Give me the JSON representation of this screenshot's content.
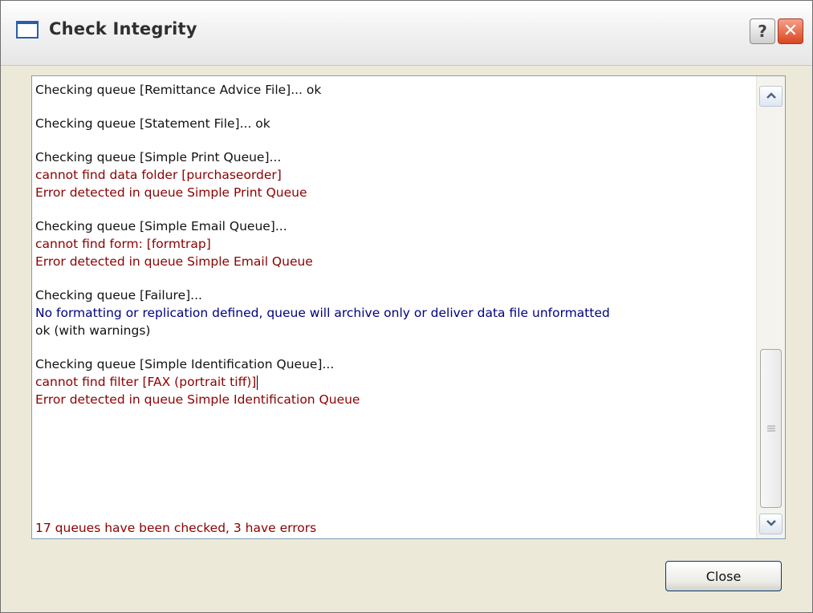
{
  "window": {
    "title": "Check Integrity",
    "help_label": "?",
    "close_label": "✕"
  },
  "log": {
    "lines": [
      {
        "text": "Checking queue [Remittance Advice File]... ok",
        "color": "black"
      },
      {
        "text": "Checking queue [Statement File]... ok",
        "color": "black"
      },
      {
        "text": "Checking queue [Simple Print Queue]...",
        "color": "black"
      },
      {
        "text": "cannot find data folder [purchaseorder]",
        "color": "red"
      },
      {
        "text": "Error detected in queue Simple Print Queue",
        "color": "red"
      },
      {
        "text": "Checking queue [Simple Email Queue]...",
        "color": "black"
      },
      {
        "text": "cannot find form: [formtrap]",
        "color": "red"
      },
      {
        "text": "Error detected in queue Simple Email Queue",
        "color": "red"
      },
      {
        "text": "Checking queue [Failure]...",
        "color": "black"
      },
      {
        "text": "No formatting or replication defined, queue will archive only or deliver data file unformatted",
        "color": "blue"
      },
      {
        "text": "ok (with warnings)",
        "color": "black"
      },
      {
        "text": "Checking queue [Simple Identification Queue]...",
        "color": "black"
      },
      {
        "text": "cannot find filter [FAX (portrait tiff)]",
        "color": "red"
      },
      {
        "text": "Error detected in queue Simple Identification Queue",
        "color": "red"
      }
    ],
    "summary": "17 queues have been checked, 3 have errors"
  },
  "colors": {
    "black": "#111111",
    "red": "#8b0000",
    "blue": "#00007f"
  },
  "scrollbar": {
    "up_icon": "chevron-up-icon",
    "down_icon": "chevron-down-icon"
  },
  "footer": {
    "close_button_label": "Close"
  }
}
